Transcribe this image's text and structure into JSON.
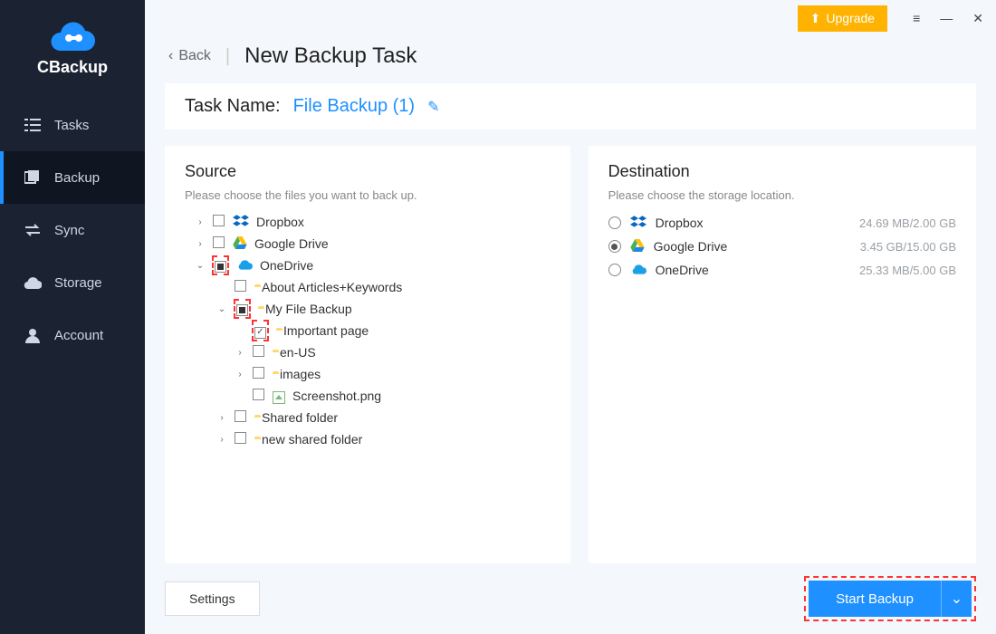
{
  "app": {
    "name": "CBackup"
  },
  "window_controls": {
    "menu": "≡",
    "minimize": "—",
    "close": "✕"
  },
  "upgrade": {
    "label": "Upgrade"
  },
  "sidebar": {
    "items": [
      {
        "label": "Tasks",
        "icon": "tasks-icon",
        "active": false
      },
      {
        "label": "Backup",
        "icon": "backup-icon",
        "active": true
      },
      {
        "label": "Sync",
        "icon": "sync-icon",
        "active": false
      },
      {
        "label": "Storage",
        "icon": "storage-icon",
        "active": false
      },
      {
        "label": "Account",
        "icon": "account-icon",
        "active": false
      }
    ]
  },
  "crumb": {
    "back": "Back",
    "title": "New Backup Task"
  },
  "task": {
    "name_label": "Task Name:",
    "name_value": "File Backup (1)"
  },
  "source": {
    "title": "Source",
    "subtitle": "Please choose the files you want to back up.",
    "tree": [
      {
        "indent": 0,
        "expander": "›",
        "check": "empty",
        "icon": "dropbox",
        "label": "Dropbox"
      },
      {
        "indent": 0,
        "expander": "›",
        "check": "empty",
        "icon": "gdrive",
        "label": "Google Drive"
      },
      {
        "indent": 0,
        "expander": "v",
        "check": "partial",
        "icon": "onedrive",
        "label": "OneDrive",
        "highlight": true
      },
      {
        "indent": 1,
        "expander": "",
        "check": "empty",
        "icon": "folder",
        "label": "About Articles+Keywords"
      },
      {
        "indent": 1,
        "expander": "v",
        "check": "partial",
        "icon": "folder",
        "label": "My File Backup",
        "highlight": true
      },
      {
        "indent": 2,
        "expander": "",
        "check": "checked",
        "icon": "folder",
        "label": "Important page",
        "highlight": true
      },
      {
        "indent": 2,
        "expander": "›",
        "check": "empty",
        "icon": "folder",
        "label": "en-US"
      },
      {
        "indent": 2,
        "expander": "›",
        "check": "empty",
        "icon": "folder",
        "label": "images"
      },
      {
        "indent": 2,
        "expander": "",
        "check": "empty",
        "icon": "image",
        "label": "Screenshot.png"
      },
      {
        "indent": 1,
        "expander": "›",
        "check": "empty",
        "icon": "folder",
        "label": "Shared folder"
      },
      {
        "indent": 1,
        "expander": "›",
        "check": "empty",
        "icon": "folder",
        "label": "new shared folder"
      }
    ]
  },
  "destination": {
    "title": "Destination",
    "subtitle": "Please choose the storage location.",
    "options": [
      {
        "label": "Dropbox",
        "icon": "dropbox",
        "selected": false,
        "size": "24.69 MB/2.00 GB"
      },
      {
        "label": "Google Drive",
        "icon": "gdrive",
        "selected": true,
        "size": "3.45 GB/15.00 GB"
      },
      {
        "label": "OneDrive",
        "icon": "onedrive",
        "selected": false,
        "size": "25.33 MB/5.00 GB"
      }
    ]
  },
  "footer": {
    "settings": "Settings",
    "start": "Start Backup"
  },
  "colors": {
    "accent": "#1e90ff",
    "upgrade": "#ffb300",
    "highlight": "#ff3333"
  }
}
